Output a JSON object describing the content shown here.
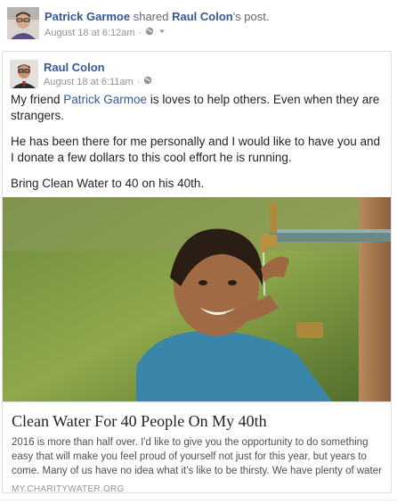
{
  "shared_header": {
    "sharer_name": "Patrick Garmoe",
    "shared_text": " shared ",
    "original_author": "Raul Colon",
    "suffix": "'s post.",
    "timestamp": "August 18 at 6:12am",
    "separator": "·",
    "privacy_icon": "globe-icon",
    "menu_icon": "chevron-down-icon"
  },
  "original_post": {
    "author": "Raul Colon",
    "timestamp": "August 18 at 6:11am",
    "separator": "·",
    "privacy_icon": "globe-icon",
    "text_p1_before": "My friend ",
    "text_p1_link": "Patrick Garmoe",
    "text_p1_after": " is loves to help others. Even when they are strangers.",
    "text_p2": "He has been there for me personally and I would like to have you and I donate a few dollars to this cool effort he is running.",
    "text_p3": "Bring Clean Water to 40 on his 40th."
  },
  "link_preview": {
    "title": "Clean Water For 40 People On My 40th",
    "description": "2016 is more than half over. I'd like to give you the opportunity to do something easy that will make you feel proud of yourself not just for this year, but years to come. Many of us have no idea what it's like to be thirsty. We have plenty of water to drink...",
    "domain": "MY.CHARITYWATER.ORG"
  },
  "colors": {
    "link": "#365899",
    "meta": "#90949c",
    "text": "#1d2129",
    "border": "#dddfe2"
  }
}
